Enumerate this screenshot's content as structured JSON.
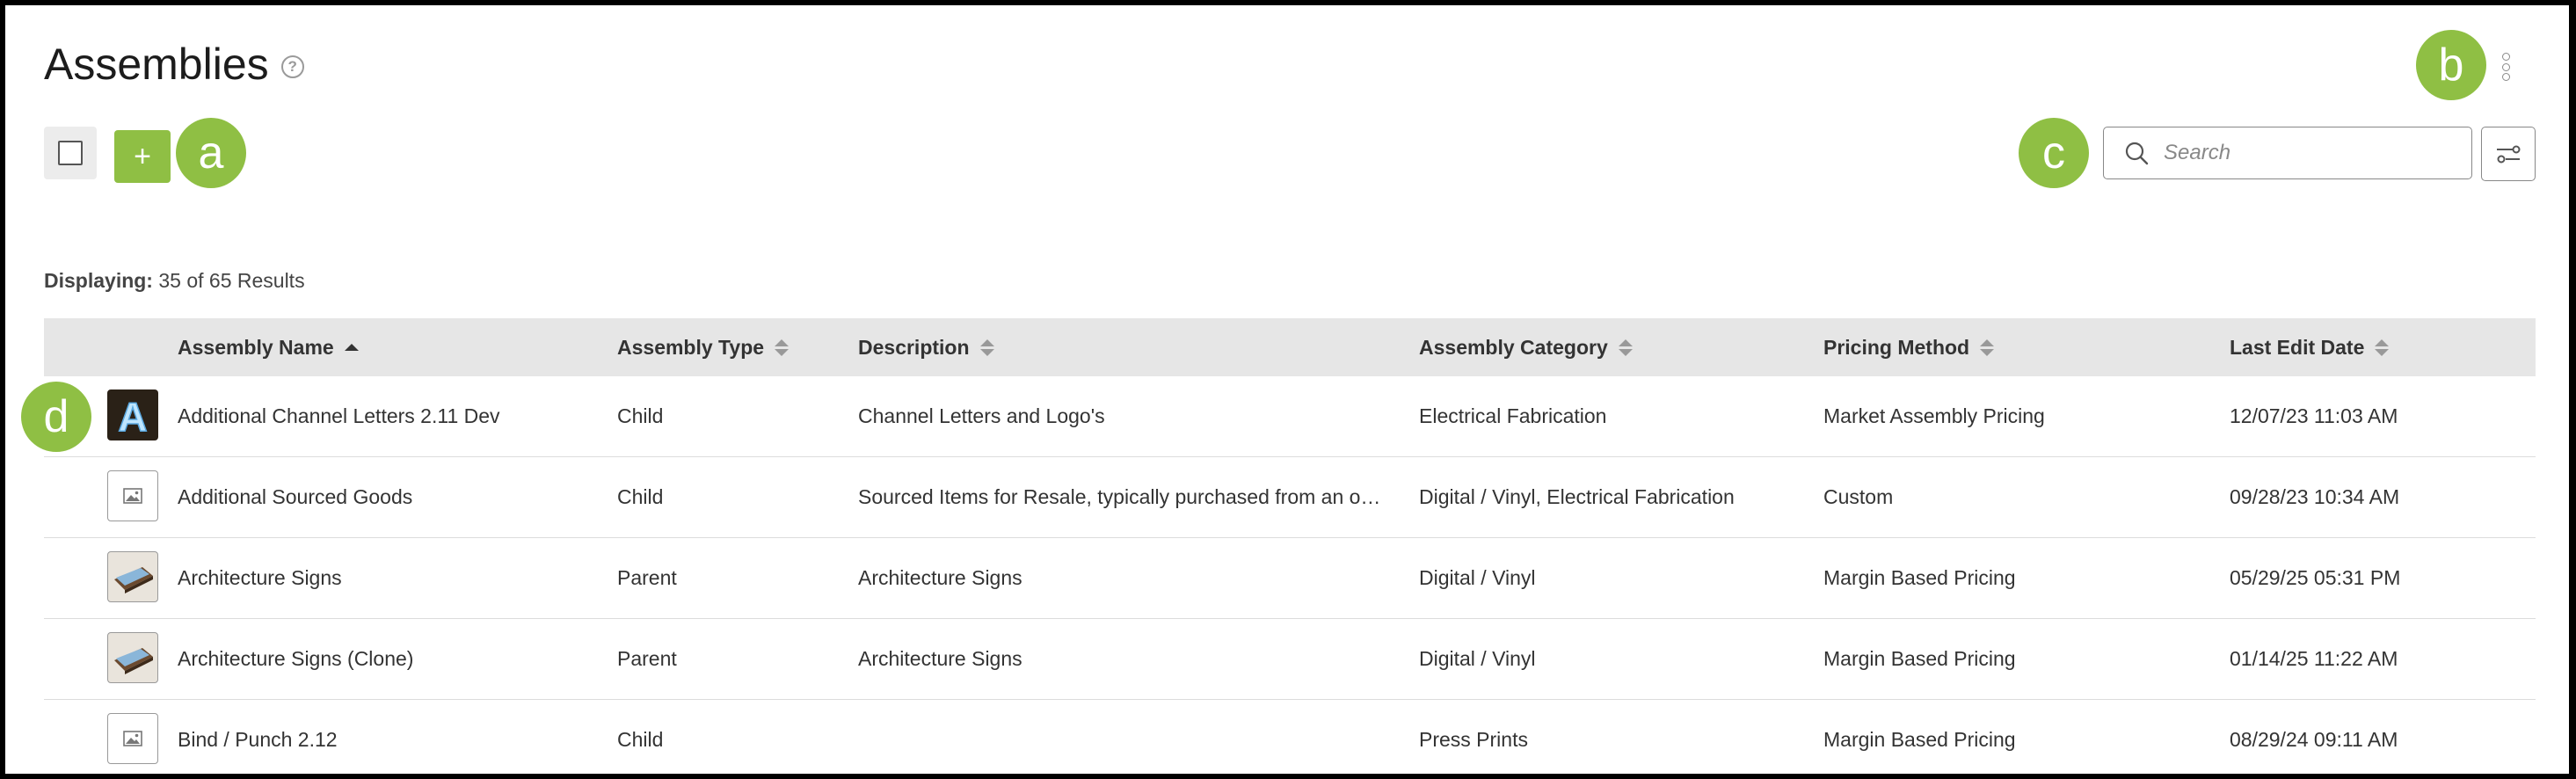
{
  "page": {
    "title": "Assemblies",
    "help_icon": "?"
  },
  "badges": {
    "a": "a",
    "b": "b",
    "c": "c",
    "d": "d"
  },
  "toolbar": {
    "add_label": "+",
    "search_placeholder": "Search"
  },
  "results": {
    "label": "Displaying:",
    "text": "35 of 65 Results"
  },
  "table": {
    "columns": [
      {
        "label": "Assembly Name"
      },
      {
        "label": "Assembly Type"
      },
      {
        "label": "Description"
      },
      {
        "label": "Assembly Category"
      },
      {
        "label": "Pricing Method"
      },
      {
        "label": "Last Edit Date"
      }
    ],
    "rows": [
      {
        "thumb": "letter-A-image",
        "name": "Additional Channel Letters 2.11 Dev",
        "type": "Child",
        "description": "Channel Letters and Logo's",
        "category": "Electrical Fabrication",
        "pricing": "Market Assembly Pricing",
        "date": "12/07/23 11:03 AM"
      },
      {
        "thumb": "image-placeholder-icon",
        "name": "Additional Sourced Goods",
        "type": "Child",
        "description": "Sourced Items for Resale, typically purchased from an o…",
        "category": "Digital / Vinyl, Electrical Fabrication",
        "pricing": "Custom",
        "date": "09/28/23 10:34 AM"
      },
      {
        "thumb": "sign-photo",
        "name": "Architecture Signs",
        "type": "Parent",
        "description": "Architecture Signs",
        "category": "Digital / Vinyl",
        "pricing": "Margin Based Pricing",
        "date": "05/29/25 05:31 PM"
      },
      {
        "thumb": "sign-photo",
        "name": "Architecture Signs (Clone)",
        "type": "Parent",
        "description": "Architecture Signs",
        "category": "Digital / Vinyl",
        "pricing": "Margin Based Pricing",
        "date": "01/14/25 11:22 AM"
      },
      {
        "thumb": "image-placeholder-icon",
        "name": "Bind / Punch 2.12",
        "type": "Child",
        "description": "",
        "category": "Press Prints",
        "pricing": "Margin Based Pricing",
        "date": "08/29/24 09:11 AM"
      }
    ]
  },
  "colors": {
    "accent": "#8fbf44",
    "header_bg": "#e6e6e6"
  }
}
